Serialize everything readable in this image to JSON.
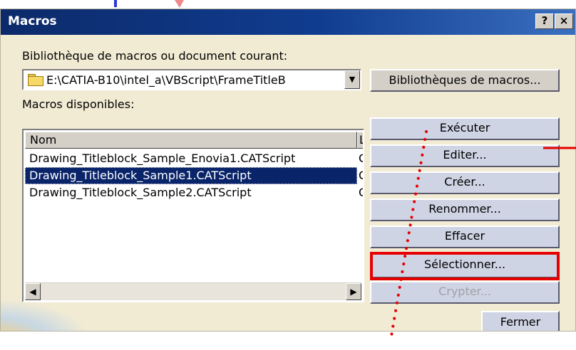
{
  "window": {
    "title": "Macros",
    "help_label": "?",
    "close_label": "×"
  },
  "library": {
    "label": "Bibliothèque de macros ou document courant:",
    "path": "E:\\CATIA-B10\\intel_a\\VBScript\\FrameTitleB",
    "dropdown_glyph": "▼",
    "libs_button": "Bibliothèques de macros..."
  },
  "macros": {
    "label": "Macros disponibles:",
    "header": "Nom",
    "header2": "L",
    "items": [
      {
        "name": "Drawing_Titleblock_Sample_Enovia1.CATScript",
        "col2": "C",
        "selected": false
      },
      {
        "name": "Drawing_Titleblock_Sample1.CATScript",
        "col2": "C",
        "selected": true
      },
      {
        "name": "Drawing_Titleblock_Sample2.CATScript",
        "col2": "C",
        "selected": false
      }
    ],
    "scroll_left": "◀",
    "scroll_right": "▶"
  },
  "actions": {
    "run": "Exécuter",
    "edit": "Editer...",
    "create": "Créer...",
    "rename": "Renommer...",
    "delete": "Effacer",
    "select": "Sélectionner...",
    "encrypt": "Crypter...",
    "close": "Fermer"
  },
  "colors": {
    "title_bar": "#0c2a6a",
    "selection": "#0a246a",
    "highlight": "#e60000",
    "dots": "#e60000"
  }
}
